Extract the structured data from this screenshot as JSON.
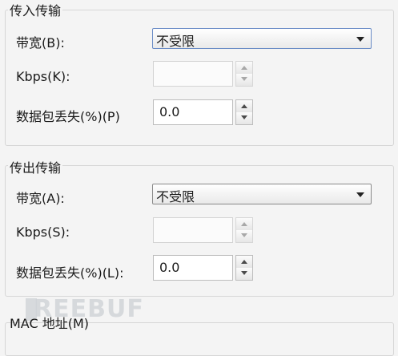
{
  "incoming": {
    "title": "传入传输",
    "bandwidth_label": "带宽(B):",
    "bandwidth_value": "不受限",
    "kbps_label": "Kbps(K):",
    "kbps_value": "",
    "loss_label": "数据包丢失(%)(P)",
    "loss_value": "0.0"
  },
  "outgoing": {
    "title": "传出传输",
    "bandwidth_label": "带宽(A):",
    "bandwidth_value": "不受限",
    "kbps_label": "Kbps(S):",
    "kbps_value": "",
    "loss_label": "数据包丢失(%)(L):",
    "loss_value": "0.0"
  },
  "mac": {
    "title": "MAC 地址(M)"
  },
  "watermark": "REEBUF",
  "icons": {
    "dropdown": "chevron-down-icon",
    "spin_up": "arrow-up-icon",
    "spin_down": "arrow-down-icon"
  }
}
